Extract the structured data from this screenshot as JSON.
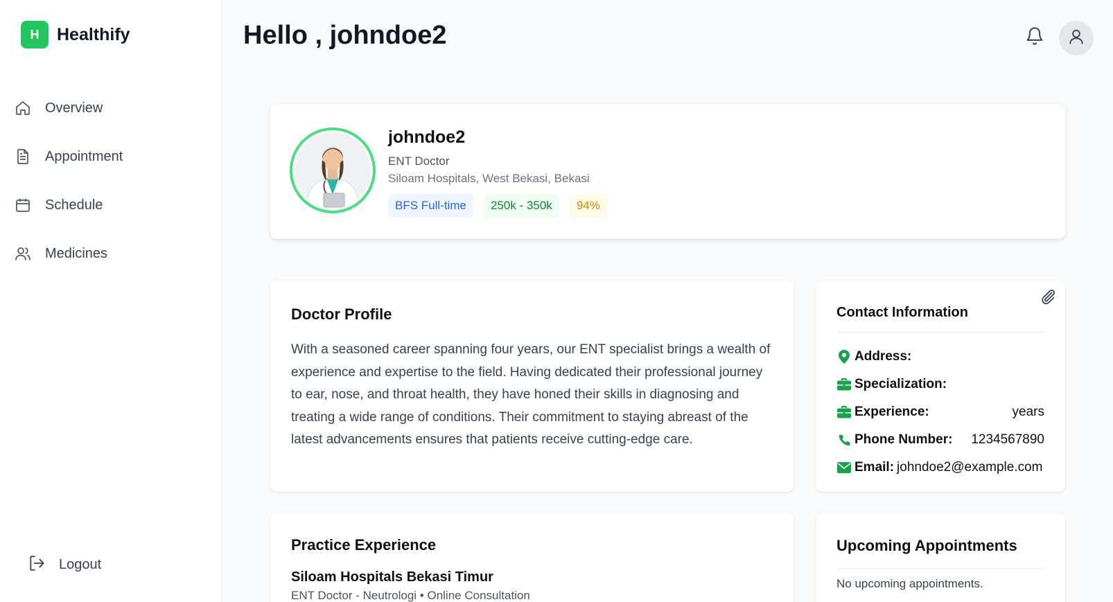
{
  "brand": {
    "logo_letter": "H",
    "name": "Healthify",
    "accent": "#22c55e"
  },
  "sidebar": {
    "items": [
      {
        "label": "Overview",
        "icon": "home-icon"
      },
      {
        "label": "Appointment",
        "icon": "document-icon"
      },
      {
        "label": "Schedule",
        "icon": "calendar-icon"
      },
      {
        "label": "Medicines",
        "icon": "users-icon"
      }
    ],
    "logout_label": "Logout"
  },
  "header": {
    "greeting": "Hello , johndoe2"
  },
  "profile": {
    "name": "johndoe2",
    "role": "ENT Doctor",
    "hospital": "Siloam Hospitals, West Bekasi, Bekasi",
    "badges": [
      "BFS Full-time",
      "250k - 350k",
      "94%"
    ]
  },
  "doctor_profile": {
    "title": "Doctor Profile",
    "bio": "With a seasoned career spanning four years, our ENT specialist brings a wealth of experience and expertise to the field. Having dedicated their professional journey to ear, nose, and throat health, they have honed their skills in diagnosing and treating a wide range of conditions. Their commitment to staying abreast of the latest advancements ensures that patients receive cutting-edge care."
  },
  "contact": {
    "title": "Contact Information",
    "address_label": "Address:",
    "address_value": "",
    "specialization_label": "Specialization:",
    "specialization_value": "",
    "experience_label": "Experience:",
    "experience_value": "years",
    "phone_label": "Phone Number:",
    "phone_value": "1234567890",
    "email_label": "Email:",
    "email_value": "johndoe2@example.com"
  },
  "practice": {
    "title": "Practice Experience",
    "hospital": "Siloam Hospitals Bekasi Timur",
    "subtitle": "ENT Doctor - Neutrologi • Online Consultation"
  },
  "upcoming": {
    "title": "Upcoming Appointments",
    "empty_text": "No upcoming appointments."
  }
}
